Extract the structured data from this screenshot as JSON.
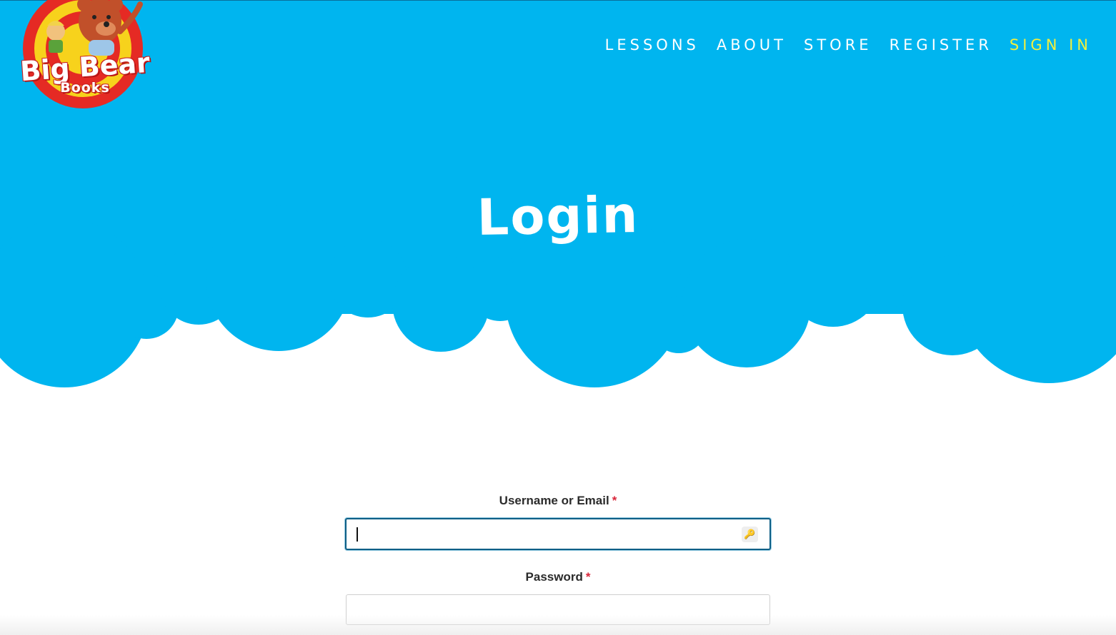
{
  "colors": {
    "sky": "#00b5ef",
    "nav_text": "#ffffff",
    "nav_active": "#f2f03d",
    "required_star": "#d9263a",
    "label_text": "#2b2b2b",
    "focus_border": "#0f5f86"
  },
  "logo": {
    "title": "Big Bear",
    "subtitle": "Books"
  },
  "nav": {
    "items": [
      {
        "label": "LESSONS",
        "active": false
      },
      {
        "label": "ABOUT",
        "active": false
      },
      {
        "label": "STORE",
        "active": false
      },
      {
        "label": "REGISTER",
        "active": false
      },
      {
        "label": "SIGN IN",
        "active": true
      }
    ]
  },
  "hero": {
    "title": "Login"
  },
  "form": {
    "username_label": "Username or Email",
    "password_label": "Password",
    "required_marker": "*",
    "username_value": "",
    "password_value": "",
    "key_icon": "key-icon"
  }
}
